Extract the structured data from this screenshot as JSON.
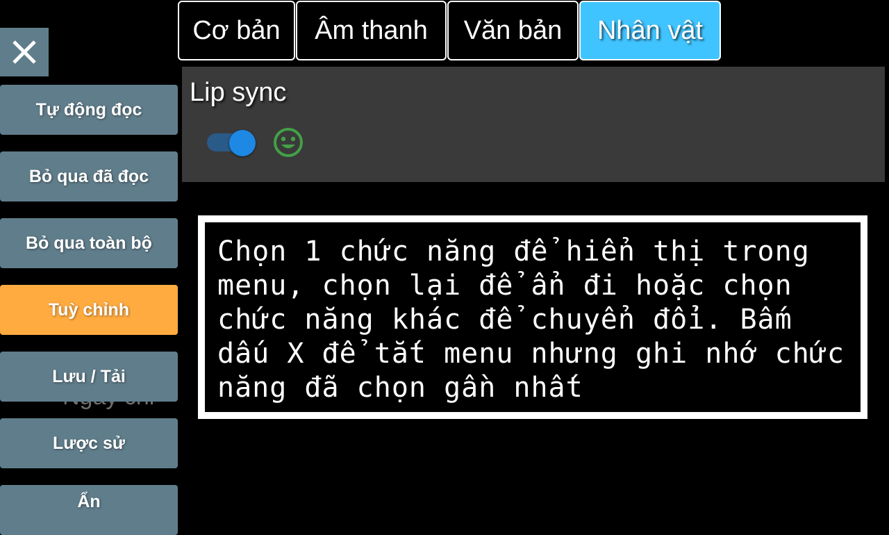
{
  "close": {
    "icon": "close-icon"
  },
  "sidebar": {
    "items": [
      {
        "label": "Tự động đọc"
      },
      {
        "label": "Bỏ qua đã đọc"
      },
      {
        "label": "Bỏ qua toàn bộ"
      },
      {
        "label": "Tuỳ chỉnh"
      },
      {
        "label": "Lưu / Tải"
      },
      {
        "label": "Lược sử"
      },
      {
        "label": "Ẩn"
      }
    ],
    "active_index": 3,
    "ghost_text": "Ngày chi"
  },
  "tabs": [
    {
      "label": "Cơ bản"
    },
    {
      "label": "Âm thanh"
    },
    {
      "label": "Văn bản"
    },
    {
      "label": "Nhân vật"
    }
  ],
  "active_tab": 3,
  "panel": {
    "title": "Lip sync",
    "toggle_on": true,
    "icon": "smiley-face-icon"
  },
  "help": {
    "text": "Chọn 1 chức năng để hiển thị trong menu, chọn lại để ẩn đi hoặc chọn chức năng khác để chuyển đổi. Bấm dấu X để tắt menu nhưng ghi nhớ chức năng đã chọn gần nhất"
  },
  "colors": {
    "sidebar_button": "#607d8b",
    "sidebar_active": "#ffab40",
    "tab_active": "#40c4ff",
    "panel_bg": "#3a3a3a",
    "toggle_on": "#1e88e5",
    "icon_green": "#43a047"
  }
}
